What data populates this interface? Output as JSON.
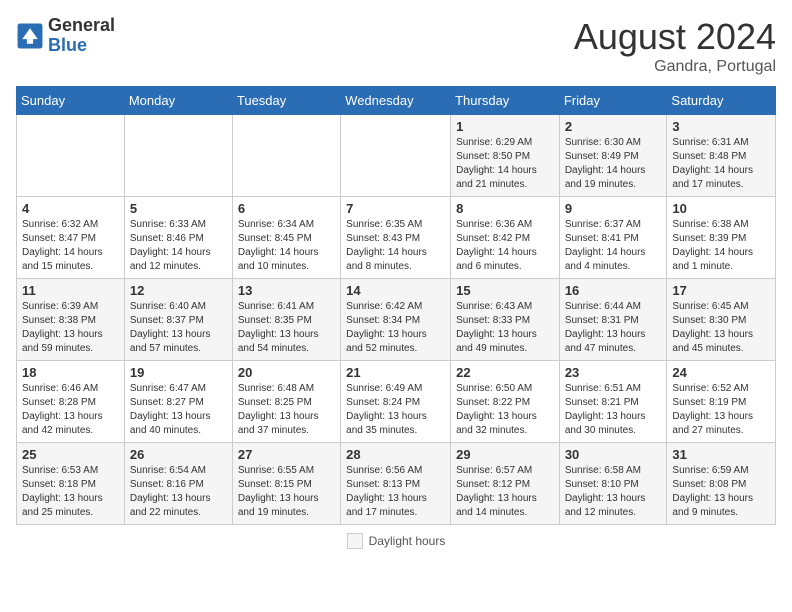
{
  "header": {
    "logo_general": "General",
    "logo_blue": "Blue",
    "month_year": "August 2024",
    "location": "Gandra, Portugal"
  },
  "legend": {
    "box_label": "Daylight hours"
  },
  "weekdays": [
    "Sunday",
    "Monday",
    "Tuesday",
    "Wednesday",
    "Thursday",
    "Friday",
    "Saturday"
  ],
  "weeks": [
    [
      {
        "day": "",
        "info": ""
      },
      {
        "day": "",
        "info": ""
      },
      {
        "day": "",
        "info": ""
      },
      {
        "day": "",
        "info": ""
      },
      {
        "day": "1",
        "info": "Sunrise: 6:29 AM\nSunset: 8:50 PM\nDaylight: 14 hours and 21 minutes."
      },
      {
        "day": "2",
        "info": "Sunrise: 6:30 AM\nSunset: 8:49 PM\nDaylight: 14 hours and 19 minutes."
      },
      {
        "day": "3",
        "info": "Sunrise: 6:31 AM\nSunset: 8:48 PM\nDaylight: 14 hours and 17 minutes."
      }
    ],
    [
      {
        "day": "4",
        "info": "Sunrise: 6:32 AM\nSunset: 8:47 PM\nDaylight: 14 hours and 15 minutes."
      },
      {
        "day": "5",
        "info": "Sunrise: 6:33 AM\nSunset: 8:46 PM\nDaylight: 14 hours and 12 minutes."
      },
      {
        "day": "6",
        "info": "Sunrise: 6:34 AM\nSunset: 8:45 PM\nDaylight: 14 hours and 10 minutes."
      },
      {
        "day": "7",
        "info": "Sunrise: 6:35 AM\nSunset: 8:43 PM\nDaylight: 14 hours and 8 minutes."
      },
      {
        "day": "8",
        "info": "Sunrise: 6:36 AM\nSunset: 8:42 PM\nDaylight: 14 hours and 6 minutes."
      },
      {
        "day": "9",
        "info": "Sunrise: 6:37 AM\nSunset: 8:41 PM\nDaylight: 14 hours and 4 minutes."
      },
      {
        "day": "10",
        "info": "Sunrise: 6:38 AM\nSunset: 8:39 PM\nDaylight: 14 hours and 1 minute."
      }
    ],
    [
      {
        "day": "11",
        "info": "Sunrise: 6:39 AM\nSunset: 8:38 PM\nDaylight: 13 hours and 59 minutes."
      },
      {
        "day": "12",
        "info": "Sunrise: 6:40 AM\nSunset: 8:37 PM\nDaylight: 13 hours and 57 minutes."
      },
      {
        "day": "13",
        "info": "Sunrise: 6:41 AM\nSunset: 8:35 PM\nDaylight: 13 hours and 54 minutes."
      },
      {
        "day": "14",
        "info": "Sunrise: 6:42 AM\nSunset: 8:34 PM\nDaylight: 13 hours and 52 minutes."
      },
      {
        "day": "15",
        "info": "Sunrise: 6:43 AM\nSunset: 8:33 PM\nDaylight: 13 hours and 49 minutes."
      },
      {
        "day": "16",
        "info": "Sunrise: 6:44 AM\nSunset: 8:31 PM\nDaylight: 13 hours and 47 minutes."
      },
      {
        "day": "17",
        "info": "Sunrise: 6:45 AM\nSunset: 8:30 PM\nDaylight: 13 hours and 45 minutes."
      }
    ],
    [
      {
        "day": "18",
        "info": "Sunrise: 6:46 AM\nSunset: 8:28 PM\nDaylight: 13 hours and 42 minutes."
      },
      {
        "day": "19",
        "info": "Sunrise: 6:47 AM\nSunset: 8:27 PM\nDaylight: 13 hours and 40 minutes."
      },
      {
        "day": "20",
        "info": "Sunrise: 6:48 AM\nSunset: 8:25 PM\nDaylight: 13 hours and 37 minutes."
      },
      {
        "day": "21",
        "info": "Sunrise: 6:49 AM\nSunset: 8:24 PM\nDaylight: 13 hours and 35 minutes."
      },
      {
        "day": "22",
        "info": "Sunrise: 6:50 AM\nSunset: 8:22 PM\nDaylight: 13 hours and 32 minutes."
      },
      {
        "day": "23",
        "info": "Sunrise: 6:51 AM\nSunset: 8:21 PM\nDaylight: 13 hours and 30 minutes."
      },
      {
        "day": "24",
        "info": "Sunrise: 6:52 AM\nSunset: 8:19 PM\nDaylight: 13 hours and 27 minutes."
      }
    ],
    [
      {
        "day": "25",
        "info": "Sunrise: 6:53 AM\nSunset: 8:18 PM\nDaylight: 13 hours and 25 minutes."
      },
      {
        "day": "26",
        "info": "Sunrise: 6:54 AM\nSunset: 8:16 PM\nDaylight: 13 hours and 22 minutes."
      },
      {
        "day": "27",
        "info": "Sunrise: 6:55 AM\nSunset: 8:15 PM\nDaylight: 13 hours and 19 minutes."
      },
      {
        "day": "28",
        "info": "Sunrise: 6:56 AM\nSunset: 8:13 PM\nDaylight: 13 hours and 17 minutes."
      },
      {
        "day": "29",
        "info": "Sunrise: 6:57 AM\nSunset: 8:12 PM\nDaylight: 13 hours and 14 minutes."
      },
      {
        "day": "30",
        "info": "Sunrise: 6:58 AM\nSunset: 8:10 PM\nDaylight: 13 hours and 12 minutes."
      },
      {
        "day": "31",
        "info": "Sunrise: 6:59 AM\nSunset: 8:08 PM\nDaylight: 13 hours and 9 minutes."
      }
    ]
  ]
}
